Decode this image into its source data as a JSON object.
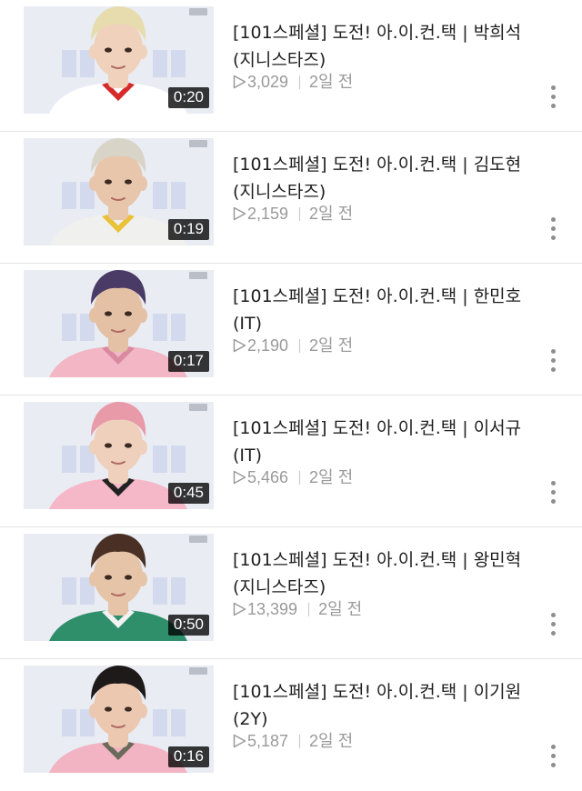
{
  "colors": {
    "meta_text": "#9a9a9a",
    "title_text": "#1e1e1e",
    "duration_badge_bg": "#000000",
    "divider": "#e3e3e3"
  },
  "icons": {
    "views": "play-outline-icon",
    "more": "more-vertical-icon"
  },
  "videos": [
    {
      "title": "[101스페셜] 도전! 아.이.컨.택 | 박희석\n(지니스타즈)",
      "duration": "0:20",
      "views": "3,029",
      "age": "2일 전",
      "hair": "#e6dcae",
      "skin": "#f0d2bc",
      "shirt": "#ffffff",
      "trim": "#d42a2a"
    },
    {
      "title": "[101스페셜] 도전! 아.이.컨.택 | 김도현\n(지니스타즈)",
      "duration": "0:19",
      "views": "2,159",
      "age": "2일 전",
      "hair": "#d8d4c8",
      "skin": "#e8c6ac",
      "shirt": "#f0f0ee",
      "trim": "#e9c23a"
    },
    {
      "title": "[101스페셜] 도전! 아.이.컨.택 | 한민호\n(IT)",
      "duration": "0:17",
      "views": "2,190",
      "age": "2일 전",
      "hair": "#4a3a66",
      "skin": "#e4c0a4",
      "shirt": "#f2b6c4",
      "trim": "#d98aa0"
    },
    {
      "title": "[101스페셜] 도전! 아.이.컨.택 | 이서규\n(IT)",
      "duration": "0:45",
      "views": "5,466",
      "age": "2일 전",
      "hair": "#e89aa8",
      "skin": "#efd0bc",
      "shirt": "#f4b8c8",
      "trim": "#222222"
    },
    {
      "title": "[101스페셜] 도전! 아.이.컨.택 | 왕민혁\n(지니스타즈)",
      "duration": "0:50",
      "views": "13,399",
      "age": "2일 전",
      "hair": "#4a3024",
      "skin": "#e6c4a8",
      "shirt": "#2f8f6a",
      "trim": "#f2f2f2"
    },
    {
      "title": "[101스페셜] 도전! 아.이.컨.택 | 이기원\n(2Y)",
      "duration": "0:16",
      "views": "5,187",
      "age": "2일 전",
      "hair": "#1e1a1a",
      "skin": "#ecc8b0",
      "shirt": "#f2b4c2",
      "trim": "#6a6a5a"
    }
  ]
}
